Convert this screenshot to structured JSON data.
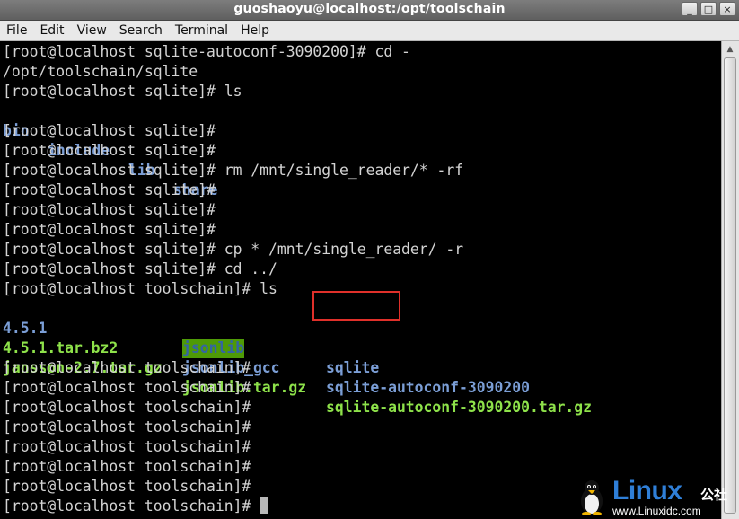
{
  "window": {
    "title": "guoshaoyu@localhost:/opt/toolschain",
    "buttons": [
      "_",
      "□",
      "×"
    ]
  },
  "menubar": {
    "items": [
      "File",
      "Edit",
      "View",
      "Search",
      "Terminal",
      "Help"
    ]
  },
  "terminal": {
    "lines": [
      "[root@localhost sqlite-autoconf-3090200]# cd -",
      "/opt/toolschain/sqlite",
      "[root@localhost sqlite]# ls",
      "",
      "[root@localhost sqlite]#",
      "[root@localhost sqlite]#",
      "[root@localhost sqlite]# rm /mnt/single_reader/* -rf",
      "[root@localhost sqlite]#",
      "[root@localhost sqlite]#",
      "[root@localhost sqlite]#",
      "[root@localhost sqlite]# cp * /mnt/single_reader/ -r",
      "[root@localhost sqlite]# cd ../",
      "[root@localhost toolschain]# ls"
    ],
    "sqlite_ls": [
      "bin",
      "include",
      "lib",
      "share"
    ],
    "toolschain_ls": {
      "row1": [
        "4.5.1",
        "jsonlib",
        "sqlite"
      ],
      "row2": [
        "4.5.1.tar.bz2",
        "jsonlib_gcc",
        "sqlite-autoconf-3090200"
      ],
      "row3": [
        "jansson-2.7.tar.gz",
        "jsonlib.tar.gz",
        "sqlite-autoconf-3090200.tar.gz"
      ]
    },
    "tail_lines": [
      "[root@localhost toolschain]#",
      "[root@localhost toolschain]#",
      "[root@localhost toolschain]#",
      "[root@localhost toolschain]#",
      "[root@localhost toolschain]#",
      "[root@localhost toolschain]#",
      "[root@localhost toolschain]#",
      "[root@localhost toolschain]#"
    ]
  },
  "watermark": {
    "brand": "Linux",
    "brand_cn": "公社",
    "url": "www.Linuxidc.com"
  },
  "colors": {
    "terminal_bg": "#000000",
    "text": "#d3d3d3",
    "directory": "#7b9ed6",
    "archive": "#8ee24a",
    "highlight_bg": "#4e9a06",
    "annotation_box": "#e0302a"
  }
}
